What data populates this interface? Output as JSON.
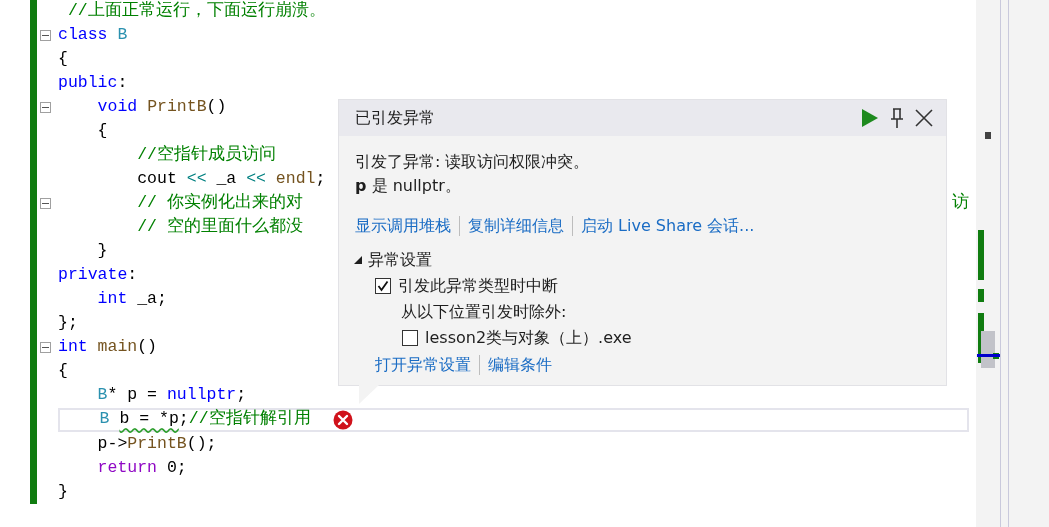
{
  "editor": {
    "lines": [
      {
        "fold": false,
        "current": false,
        "error": false,
        "tokens": [
          {
            "kind": "comment",
            "text": " //上面正常运行，下面运行崩溃。"
          }
        ]
      },
      {
        "fold": true,
        "current": false,
        "error": false,
        "tokens": [
          {
            "kind": "keyword",
            "text": "class "
          },
          {
            "kind": "type",
            "text": "B"
          }
        ]
      },
      {
        "fold": false,
        "current": false,
        "error": false,
        "tokens": [
          {
            "kind": "plain",
            "text": "{"
          }
        ]
      },
      {
        "fold": false,
        "current": false,
        "error": false,
        "tokens": [
          {
            "kind": "keyword",
            "text": "public"
          },
          {
            "kind": "plain",
            "text": ":"
          }
        ]
      },
      {
        "fold": true,
        "current": false,
        "error": false,
        "tokens": [
          {
            "kind": "keyword",
            "text": "    void "
          },
          {
            "kind": "function",
            "text": "PrintB"
          },
          {
            "kind": "plain",
            "text": "()"
          }
        ]
      },
      {
        "fold": false,
        "current": false,
        "error": false,
        "tokens": [
          {
            "kind": "plain",
            "text": "    {"
          }
        ]
      },
      {
        "fold": false,
        "current": false,
        "error": false,
        "tokens": [
          {
            "kind": "comment",
            "text": "        //空指针成员访问"
          }
        ]
      },
      {
        "fold": false,
        "current": false,
        "error": false,
        "tokens": [
          {
            "kind": "plain",
            "text": "        cout "
          },
          {
            "kind": "operator",
            "text": "<<"
          },
          {
            "kind": "plain",
            "text": " _a "
          },
          {
            "kind": "operator",
            "text": "<<"
          },
          {
            "kind": "function",
            "text": " endl"
          },
          {
            "kind": "plain",
            "text": ";"
          }
        ]
      },
      {
        "fold": true,
        "current": false,
        "error": false,
        "tokens": [
          {
            "kind": "comment",
            "text": "        // 你实例化出来的对"
          }
        ],
        "tail": "访"
      },
      {
        "fold": false,
        "current": false,
        "error": false,
        "tokens": [
          {
            "kind": "comment",
            "text": "        // 空的里面什么都没"
          }
        ]
      },
      {
        "fold": false,
        "current": false,
        "error": false,
        "tokens": [
          {
            "kind": "plain",
            "text": "    }"
          }
        ]
      },
      {
        "fold": false,
        "current": false,
        "error": false,
        "tokens": [
          {
            "kind": "keyword",
            "text": "private"
          },
          {
            "kind": "plain",
            "text": ":"
          }
        ]
      },
      {
        "fold": false,
        "current": false,
        "error": false,
        "tokens": [
          {
            "kind": "keyword",
            "text": "    int"
          },
          {
            "kind": "plain",
            "text": " _a;"
          }
        ]
      },
      {
        "fold": false,
        "current": false,
        "error": false,
        "tokens": [
          {
            "kind": "plain",
            "text": "};"
          }
        ]
      },
      {
        "fold": true,
        "current": false,
        "error": false,
        "tokens": [
          {
            "kind": "keyword",
            "text": "int "
          },
          {
            "kind": "function",
            "text": "main"
          },
          {
            "kind": "plain",
            "text": "()"
          }
        ]
      },
      {
        "fold": false,
        "current": false,
        "error": false,
        "tokens": [
          {
            "kind": "plain",
            "text": "{"
          }
        ]
      },
      {
        "fold": false,
        "current": false,
        "error": false,
        "tokens": [
          {
            "kind": "type",
            "text": "    B"
          },
          {
            "kind": "plain",
            "text": "* p = "
          },
          {
            "kind": "keyword",
            "text": "nullptr"
          },
          {
            "kind": "plain",
            "text": ";"
          }
        ]
      },
      {
        "fold": false,
        "current": true,
        "error": true,
        "tokens": [
          {
            "kind": "type",
            "text": "    B "
          },
          {
            "kind": "warning",
            "text": "b = *p"
          },
          {
            "kind": "plain",
            "text": ";"
          },
          {
            "kind": "comment",
            "text": "//空指针解引用"
          }
        ]
      },
      {
        "fold": false,
        "current": false,
        "error": false,
        "tokens": [
          {
            "kind": "plain",
            "text": "    p->"
          },
          {
            "kind": "function",
            "text": "PrintB"
          },
          {
            "kind": "plain",
            "text": "();"
          }
        ]
      },
      {
        "fold": false,
        "current": false,
        "error": false,
        "tokens": [
          {
            "kind": "control",
            "text": "    return"
          },
          {
            "kind": "plain",
            "text": " 0;"
          }
        ]
      },
      {
        "fold": false,
        "current": false,
        "error": false,
        "tokens": [
          {
            "kind": "plain",
            "text": "}"
          }
        ]
      }
    ]
  },
  "exception_popup": {
    "title": "已引发异常",
    "message": "引发了异常: 读取访问权限冲突。",
    "detail": "**p** 是 nullptr。",
    "links": [
      "显示调用堆栈",
      "复制详细信息",
      "启动 Live Share 会话..."
    ],
    "settings": {
      "title": "异常设置",
      "expanded": true,
      "break_option": {
        "label": "引发此异常类型时中断",
        "checked": true
      },
      "except_label": "从以下位置引发时除外:",
      "exceptions": [
        {
          "label": "lesson2类与对象（上）.exe",
          "checked": false
        }
      ],
      "links": [
        "打开异常设置",
        "编辑条件"
      ]
    }
  }
}
